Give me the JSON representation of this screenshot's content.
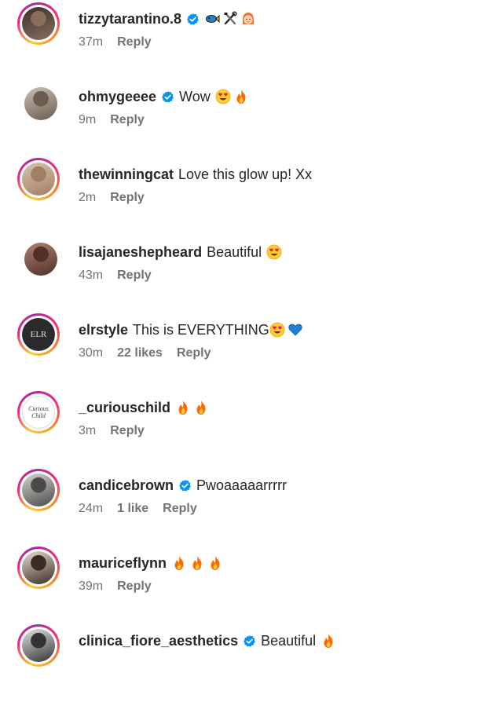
{
  "colors": {
    "text": "#262626",
    "meta": "#737373",
    "verified": "#0095f6",
    "fire": "#ff6a00"
  },
  "comments": [
    {
      "username": "tizzytarantino.8",
      "verified": true,
      "text": "",
      "emojis": [
        "fish",
        "tools",
        "girl-face"
      ],
      "time": "37m",
      "likes": "",
      "reply": "Reply",
      "avatar": "story",
      "avatar_colors": [
        "#3b3030",
        "#8a6e5c"
      ]
    },
    {
      "username": "ohmygeeee",
      "verified": true,
      "text": "Wow",
      "emojis": [
        "heart-eyes",
        "fire"
      ],
      "time": "9m",
      "likes": "",
      "reply": "Reply",
      "avatar": "plain",
      "avatar_colors": [
        "#c8c1b6",
        "#6b5c4e"
      ]
    },
    {
      "username": "thewinningcat",
      "verified": false,
      "text": "Love this glow up! Xx",
      "emojis": [],
      "time": "2m",
      "likes": "",
      "reply": "Reply",
      "avatar": "story",
      "avatar_colors": [
        "#d9c3ad",
        "#a07f62"
      ]
    },
    {
      "username": "lisajaneshepheard",
      "verified": false,
      "text": "Beautiful",
      "emojis": [
        "heart-eyes"
      ],
      "time": "43m",
      "likes": "",
      "reply": "Reply",
      "avatar": "plain",
      "avatar_colors": [
        "#b08070",
        "#503028"
      ]
    },
    {
      "username": "elrstyle",
      "verified": false,
      "text": "This is EVERYTHING",
      "emojis": [
        "heart-eyes",
        "blue-heart"
      ],
      "time": "30m",
      "likes": "22 likes",
      "reply": "Reply",
      "avatar": "story",
      "avatar_colors": [
        "#2b2b2b",
        "#2b2b2b"
      ],
      "avatar_text": "ELR"
    },
    {
      "username": "_curiouschild",
      "verified": false,
      "text": "",
      "emojis": [
        "fire",
        "fire"
      ],
      "time": "3m",
      "likes": "",
      "reply": "Reply",
      "avatar": "story",
      "avatar_colors": [
        "#ffffff",
        "#ffffff"
      ],
      "avatar_text": "Curious Child"
    },
    {
      "username": "candicebrown",
      "verified": true,
      "text": "Pwoaaaaarrrrr",
      "emojis": [],
      "time": "24m",
      "likes": "1 like",
      "reply": "Reply",
      "avatar": "story",
      "avatar_colors": [
        "#d7d2cc",
        "#4a4a4a"
      ]
    },
    {
      "username": "mauriceflynn",
      "verified": false,
      "text": "",
      "emojis": [
        "fire",
        "fire",
        "fire"
      ],
      "time": "39m",
      "likes": "",
      "reply": "Reply",
      "avatar": "story",
      "avatar_colors": [
        "#e6ddd2",
        "#3a2c22"
      ]
    },
    {
      "username": "clinica_fiore_aesthetics",
      "verified": true,
      "text": "Beautiful",
      "emojis": [
        "fire"
      ],
      "time": "",
      "likes": "",
      "reply": "",
      "avatar": "story",
      "avatar_colors": [
        "#e3e3e3",
        "#333333"
      ]
    }
  ]
}
